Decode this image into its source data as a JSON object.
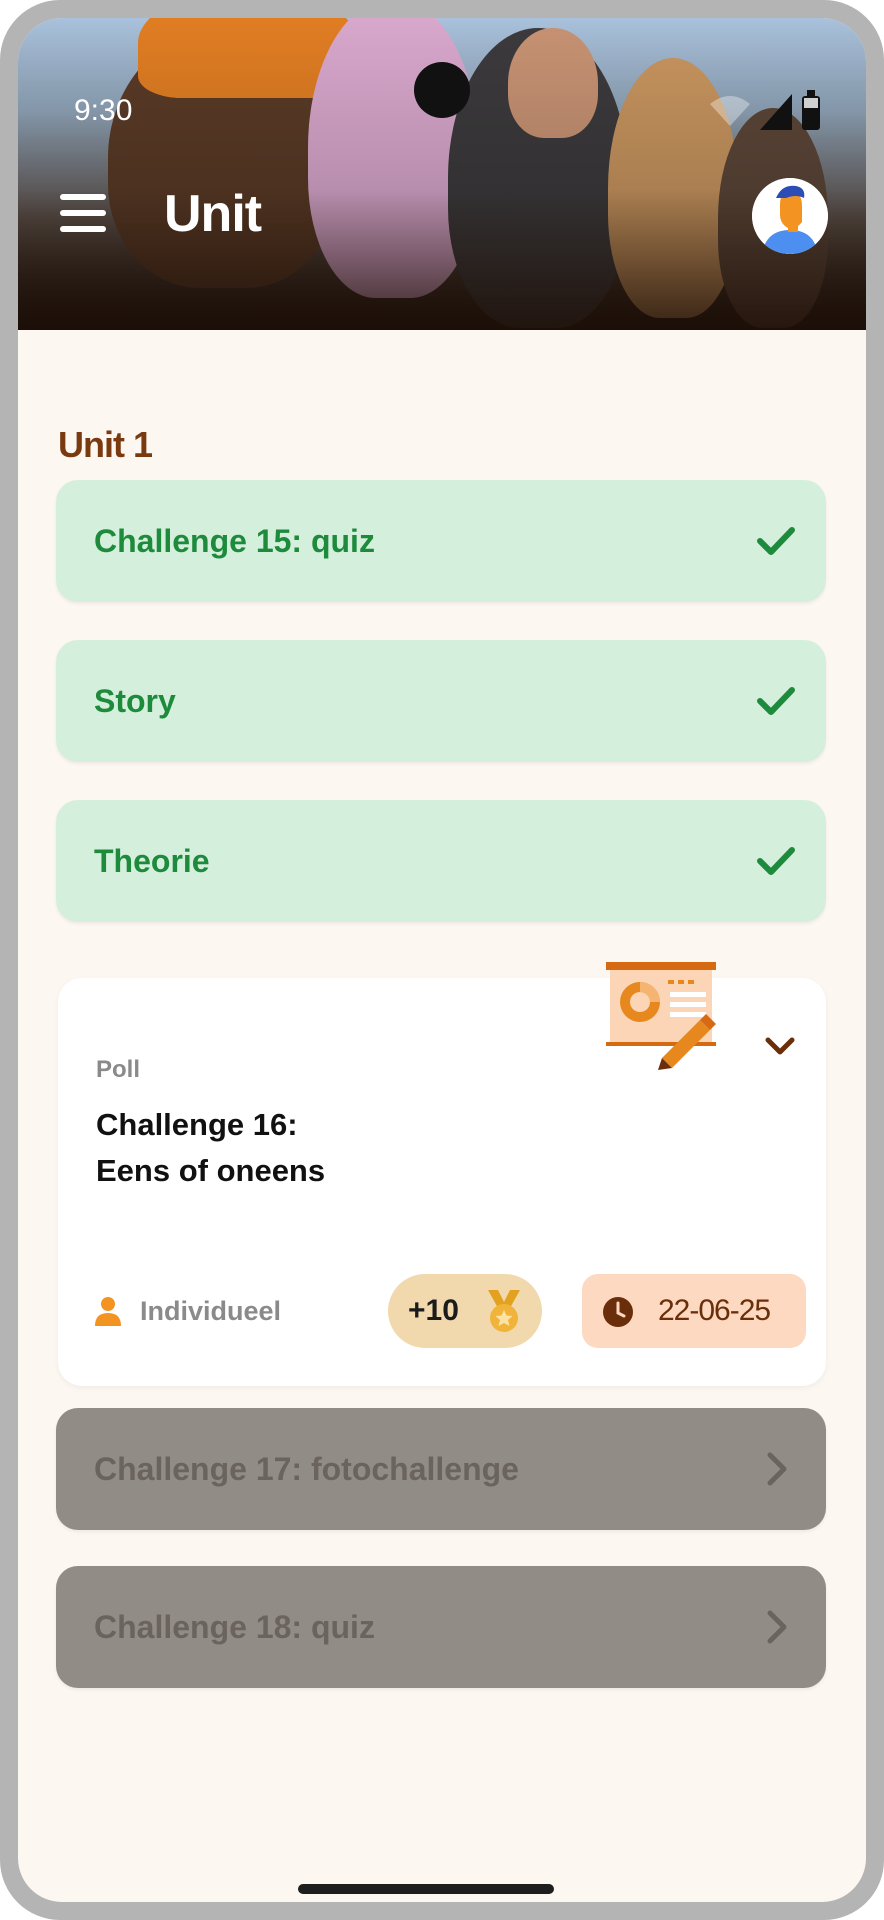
{
  "status": {
    "time": "9:30"
  },
  "header": {
    "title": "Unit"
  },
  "section": {
    "title": "Unit 1"
  },
  "completed_items": [
    {
      "label": "Challenge 15: quiz"
    },
    {
      "label": "Story"
    },
    {
      "label": "Theorie"
    }
  ],
  "active_card": {
    "type": "Poll",
    "title_line1": "Challenge 16:",
    "title_line2": "Eens of oneens",
    "mode": "Individueel",
    "points": "+10",
    "due_date": "22-06-25"
  },
  "locked_items": [
    {
      "label": "Challenge 17: fotochallenge"
    },
    {
      "label": "Challenge 18: quiz"
    }
  ],
  "colors": {
    "done_bg": "#d5efdd",
    "done_text": "#1e8a3c",
    "locked_bg": "#928c87",
    "accent": "#7a3a10",
    "points_bg": "#f1d8ad",
    "date_bg": "#fcd9c0"
  },
  "icons": {
    "menu": "hamburger-menu-icon",
    "done": "checkmark-icon",
    "locked": "chevron-right-icon",
    "expand": "chevron-down-icon",
    "mode": "person-icon",
    "points": "medal-icon",
    "date": "clock-icon"
  }
}
